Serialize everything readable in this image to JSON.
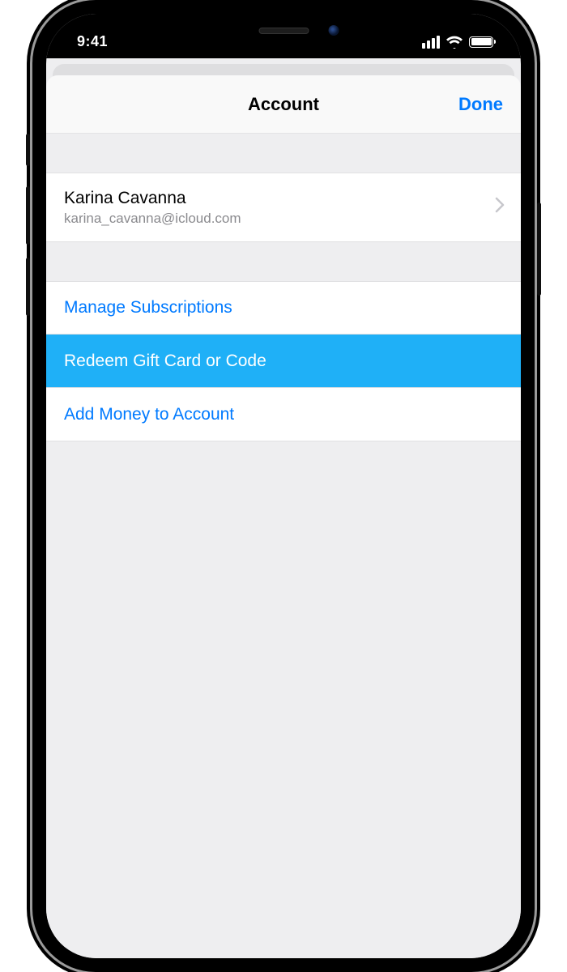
{
  "status": {
    "time": "9:41"
  },
  "sheet": {
    "title": "Account",
    "done": "Done"
  },
  "user": {
    "name": "Karina Cavanna",
    "email": "karina_cavanna@icloud.com"
  },
  "actions": {
    "manage": "Manage Subscriptions",
    "redeem": "Redeem Gift Card or Code",
    "addMoney": "Add Money to Account"
  },
  "colors": {
    "tint": "#007aff",
    "highlight": "#1fb0f7"
  }
}
